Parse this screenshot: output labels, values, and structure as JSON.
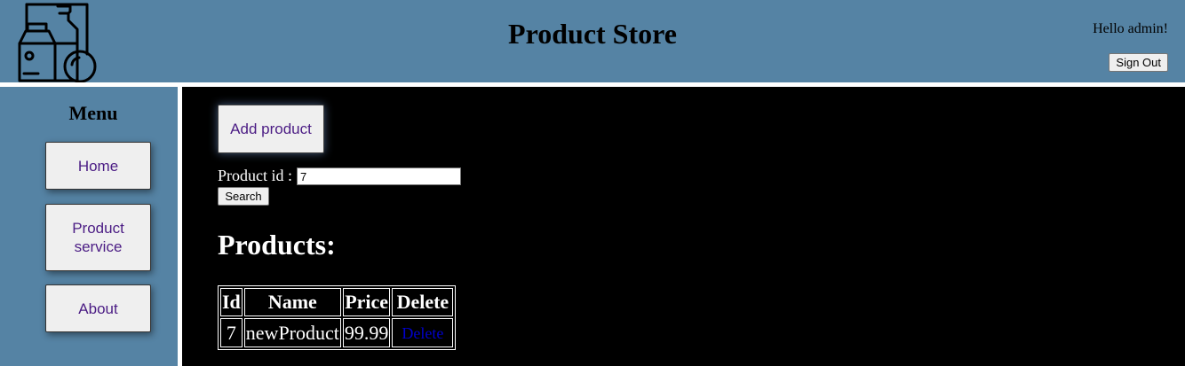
{
  "header": {
    "title": "Product Store",
    "greeting": "Hello admin!",
    "signout_label": "Sign Out",
    "logo_icon": "grocery-products-icon"
  },
  "sidebar": {
    "title": "Menu",
    "items": [
      {
        "label": "Home"
      },
      {
        "label": "Product\nservice"
      },
      {
        "label": "About"
      }
    ]
  },
  "main": {
    "add_label": "Add product",
    "search": {
      "label": "Product id :",
      "value": "7",
      "button_label": "Search"
    },
    "products_title": "Products:",
    "table": {
      "headers": [
        "Id",
        "Name",
        "Price",
        "Delete"
      ],
      "rows": [
        {
          "id": "7",
          "name": "newProduct",
          "price": "99.99",
          "delete_label": "Delete"
        }
      ]
    }
  },
  "colors": {
    "header_bg": "#5583a4",
    "main_bg": "#000000",
    "button_text": "#4b1c84",
    "link": "#0000cc"
  }
}
